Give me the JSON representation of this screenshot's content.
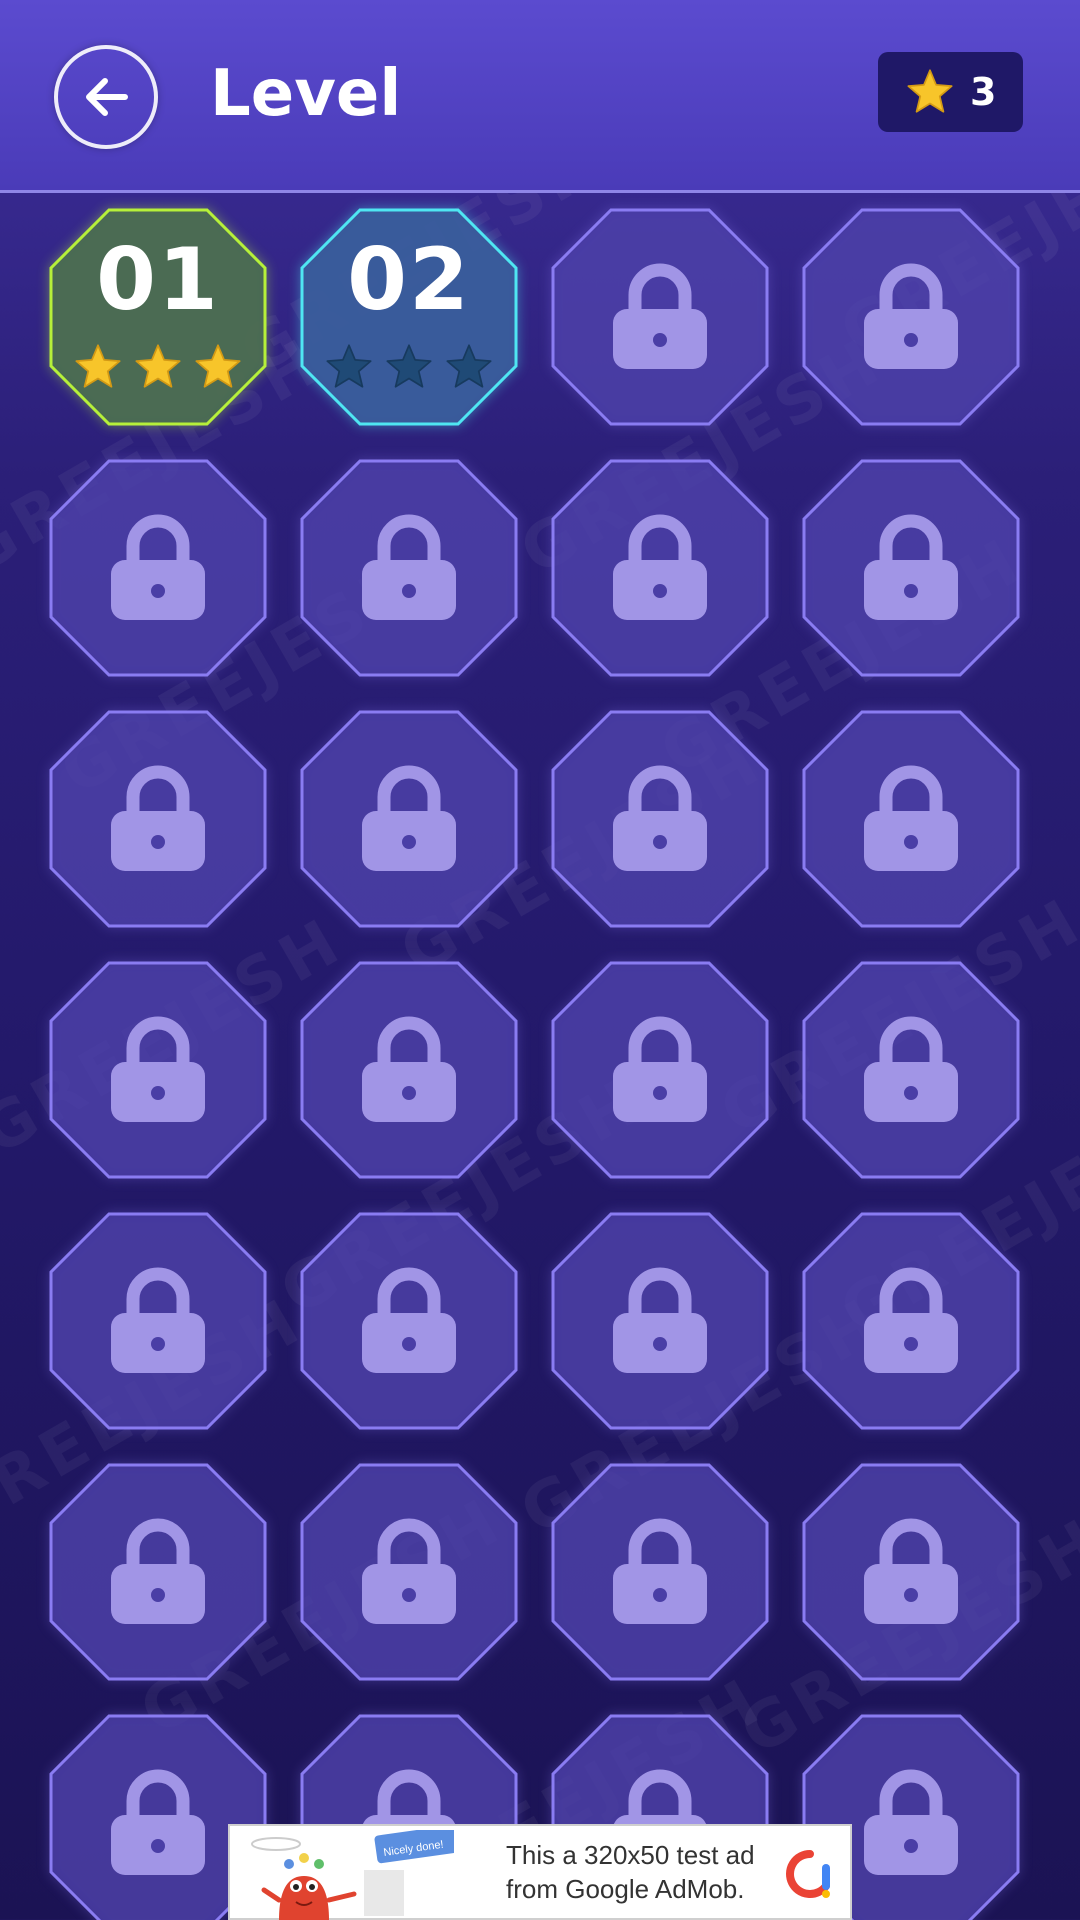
{
  "header": {
    "title": "Level",
    "back_icon": "arrow-left-icon",
    "star_count": "3"
  },
  "levels": [
    {
      "number": "01",
      "locked": false,
      "stars_earned": 3,
      "status": "completed"
    },
    {
      "number": "02",
      "locked": false,
      "stars_earned": 0,
      "status": "current"
    },
    {
      "locked": true
    },
    {
      "locked": true
    },
    {
      "locked": true
    },
    {
      "locked": true
    },
    {
      "locked": true
    },
    {
      "locked": true
    },
    {
      "locked": true
    },
    {
      "locked": true
    },
    {
      "locked": true
    },
    {
      "locked": true
    },
    {
      "locked": true
    },
    {
      "locked": true
    },
    {
      "locked": true
    },
    {
      "locked": true
    },
    {
      "locked": true
    },
    {
      "locked": true
    },
    {
      "locked": true
    },
    {
      "locked": true
    },
    {
      "locked": true
    },
    {
      "locked": true
    },
    {
      "locked": true
    },
    {
      "locked": true
    },
    {
      "locked": true
    },
    {
      "locked": true
    },
    {
      "locked": true
    },
    {
      "locked": true
    }
  ],
  "ad": {
    "text_line1": "This a 320x50 test ad",
    "text_line2": "from Google AdMob.",
    "badge_text": "Nicely done!"
  },
  "watermark_text": "GREEJESH",
  "colors": {
    "completed_border": "#b6f03a",
    "completed_fill": "#4a6a52",
    "current_border": "#4fe6f2",
    "current_fill": "#3a5a9a",
    "locked_border": "#8a7cf2",
    "locked_fill": "#4a3ea6",
    "gold_star": "#f7c52a",
    "empty_star": "#1f4a76",
    "lock": "#a195e6"
  }
}
